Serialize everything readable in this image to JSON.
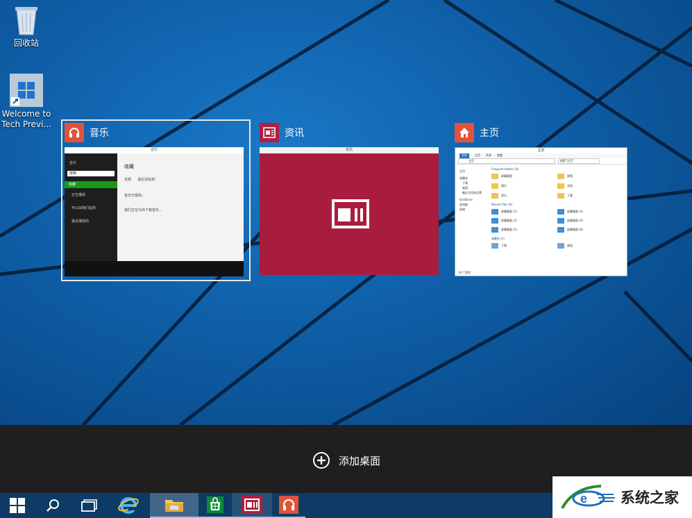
{
  "desktop": {
    "icons": [
      {
        "label": "回收站"
      },
      {
        "label": "Welcome to Tech Previ..."
      }
    ]
  },
  "views": [
    {
      "title": "音乐",
      "icon": "headphones-icon",
      "color": "#e0533a",
      "selected": true
    },
    {
      "title": "资讯",
      "icon": "news-icon",
      "color": "#b0203f",
      "selected": false
    },
    {
      "title": "主页",
      "icon": "home-icon",
      "color": "#e0533a",
      "selected": false
    }
  ],
  "music_app": {
    "window_title": "音乐",
    "sidebar_title": "音乐",
    "search_placeholder": "搜索",
    "nav": [
      "收藏",
      "正在播放",
      "可以由我们提供",
      "最近播放的"
    ],
    "main_title": "收藏",
    "filter_a": "全部",
    "filter_b": "最近添加的",
    "text_a": "音乐已保存。",
    "text_b": "我们正在为你下载音乐..."
  },
  "news_app": {
    "window_title": "资讯"
  },
  "explorer_app": {
    "window_title": "主页",
    "tabs": [
      "文件",
      "主页",
      "共享",
      "查看"
    ],
    "address": "主页",
    "search": "搜索\"主页\"",
    "nav": [
      "主页",
      "收藏夹",
      "下载",
      "桌面",
      "最近访问的位置",
      "OneDrive",
      "此电脑",
      "网络"
    ],
    "frequent_header": "Frequent folders (6)",
    "frequent": [
      "屏幕截图",
      "视频",
      "图片",
      "文档",
      "音乐",
      "下载"
    ],
    "recent_header": "Recent files (6)",
    "recent": [
      "屏幕截图 (1)",
      "屏幕截图 (2)",
      "屏幕截图 (3)",
      "屏幕截图 (4)",
      "屏幕截图 (5)",
      "屏幕截图 (6)"
    ],
    "fav_header": "收藏夹 (2)",
    "fav": [
      "下载",
      "桌面"
    ],
    "status": "14 个项目"
  },
  "add_desktop": {
    "label": "添加桌面"
  },
  "taskbar": {
    "items": [
      {
        "name": "start-button",
        "icon": "windows-logo-icon"
      },
      {
        "name": "search-button",
        "icon": "search-icon"
      },
      {
        "name": "task-view-button",
        "icon": "task-view-icon"
      },
      {
        "name": "ie-button",
        "icon": "internet-explorer-icon"
      },
      {
        "name": "file-explorer-button",
        "icon": "folder-icon"
      },
      {
        "name": "store-button",
        "icon": "store-icon"
      },
      {
        "name": "news-button",
        "icon": "news-icon"
      },
      {
        "name": "music-button",
        "icon": "headphones-icon"
      }
    ]
  },
  "watermark": {
    "text": "系统之家"
  }
}
